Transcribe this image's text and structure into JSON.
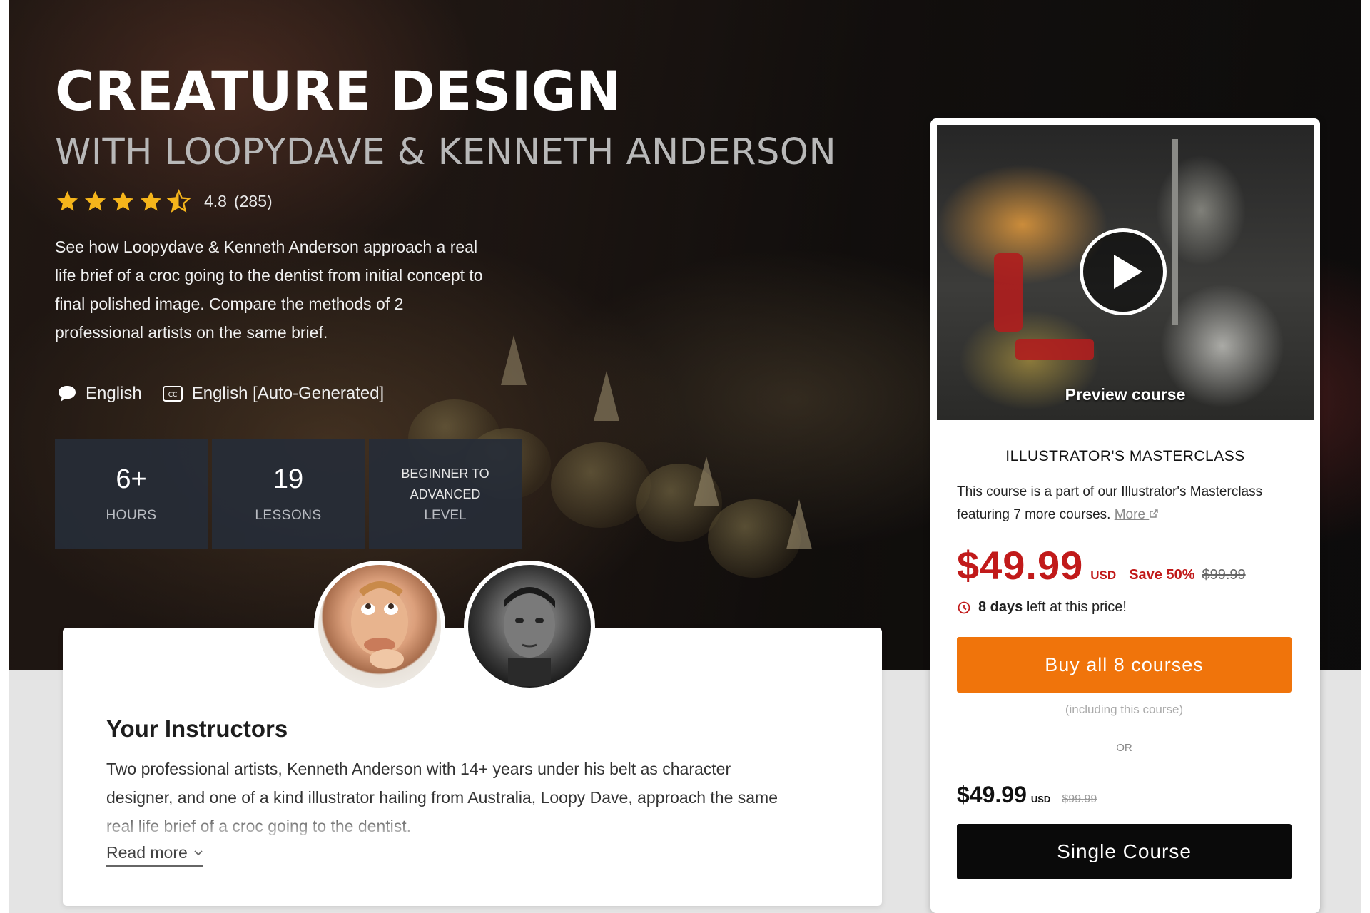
{
  "course": {
    "title": "CREATURE DESIGN",
    "subtitle": "WITH LOOPYDAVE & KENNETH ANDERSON",
    "rating": 4.8,
    "rating_text": "4.8",
    "review_count_text": "(285)",
    "description": "See how Loopydave & Kenneth Anderson approach a real life brief of a croc going to the dentist from initial concept to final polished image. Compare the methods of 2 professional artists on the same brief.",
    "audio_language": "English",
    "subtitle_language": "English [Auto-Generated]"
  },
  "stats": {
    "hours_value": "6+",
    "hours_label": "HOURS",
    "lessons_value": "19",
    "lessons_label": "LESSONS",
    "level_line1": "BEGINNER TO",
    "level_line2": "ADVANCED",
    "level_label": "LEVEL"
  },
  "instructors": {
    "heading": "Your Instructors",
    "text": "Two professional artists, Kenneth Anderson with 14+ years under his belt as character designer, and one of a kind illustrator hailing from Australia, Loopy Dave, approach the same real life brief of a croc going to the dentist.",
    "read_more": "Read more"
  },
  "purchase": {
    "preview_label": "Preview course",
    "masterclass_title": "ILLUSTRATOR'S MASTERCLASS",
    "masterclass_desc": "This course is a part of our Illustrator's Masterclass featuring 7 more courses.",
    "more_link": "More",
    "price": "$49.99",
    "currency": "USD",
    "save_text": "Save 50%",
    "original_price": "$99.99",
    "deadline_bold": "8 days",
    "deadline_rest": "left at this price!",
    "buy_all_label": "Buy all 8 courses",
    "including_text": "(including this course)",
    "or_text": "OR",
    "single_price": "$49.99",
    "single_currency": "USD",
    "single_original_price": "$99.99",
    "single_course_label": "Single Course"
  },
  "colors": {
    "accent_orange": "#f0740b",
    "price_red": "#c11a1a",
    "star_yellow": "#f5b51b",
    "stat_box": "#262d37"
  },
  "icons": {
    "audio": "speech-bubble-icon",
    "subtitles": "closed-captions-icon",
    "timer": "clock-icon",
    "external": "external-link-icon",
    "play": "play-icon",
    "chevron": "chevron-down-icon"
  }
}
